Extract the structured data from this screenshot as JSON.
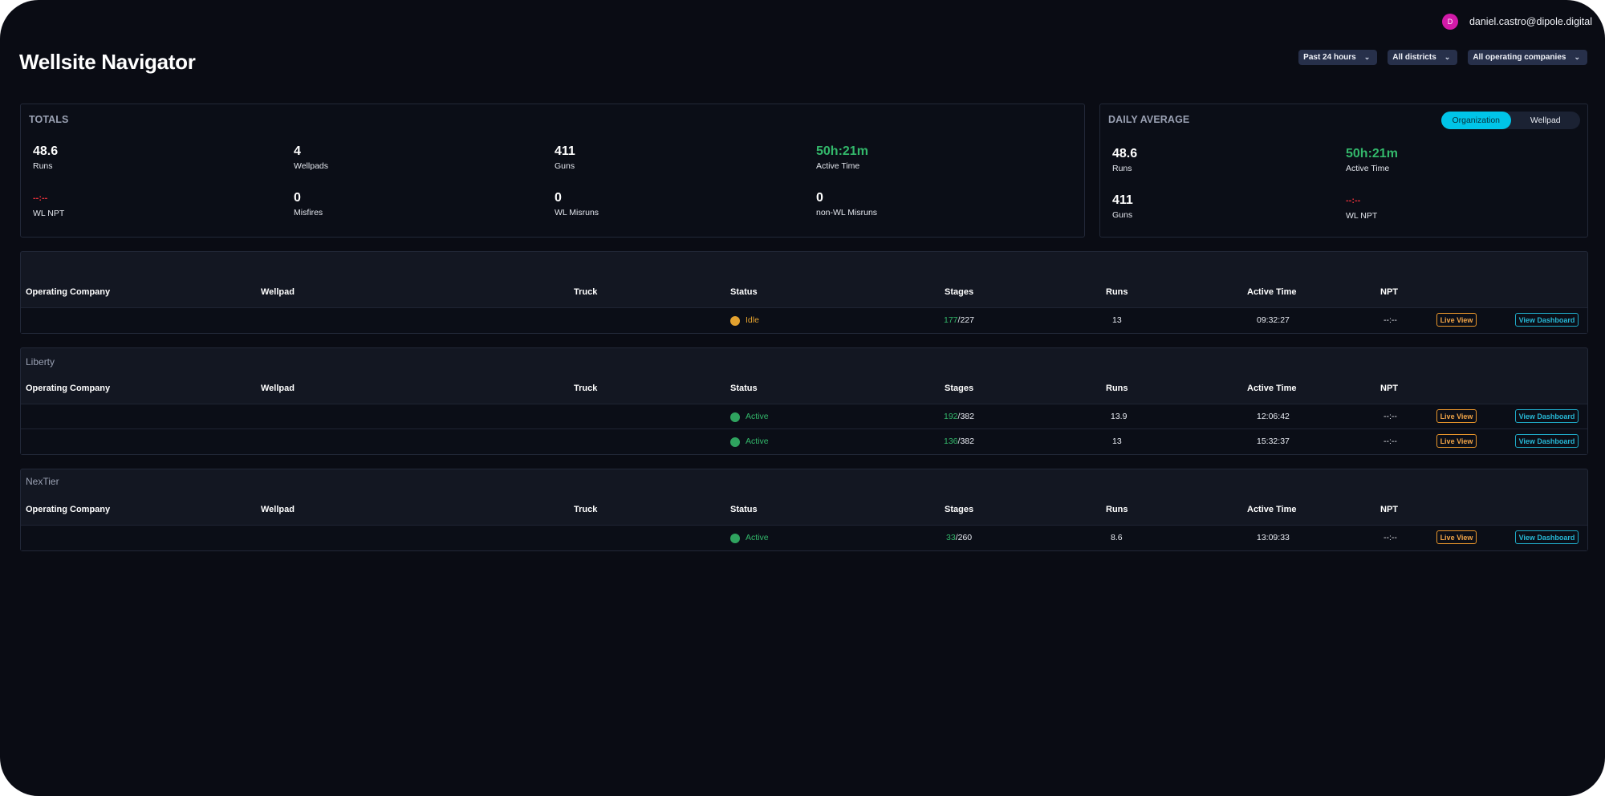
{
  "header": {
    "user_initial": "D",
    "user_email": "daniel.castro@dipole.digital",
    "title": "Wellsite Navigator"
  },
  "filters": [
    {
      "label": "Past 24 hours"
    },
    {
      "label": "All districts"
    },
    {
      "label": "All operating companies"
    }
  ],
  "totals": {
    "title": "TOTALS",
    "stats": [
      {
        "value": "48.6",
        "label": "Runs"
      },
      {
        "value": "4",
        "label": "Wellpads"
      },
      {
        "value": "411",
        "label": "Guns"
      },
      {
        "value": "50h:21m",
        "label": "Active Time"
      },
      {
        "value": "--:--",
        "label": "WL NPT"
      },
      {
        "value": "0",
        "label": "Misfires"
      },
      {
        "value": "0",
        "label": "WL Misruns"
      },
      {
        "value": "0",
        "label": "non-WL Misruns"
      }
    ]
  },
  "daily_average": {
    "title": "DAILY AVERAGE",
    "toggle": {
      "options": [
        "Organization",
        "Wellpad"
      ],
      "selected": "Organization"
    },
    "stats": [
      {
        "value": "48.6",
        "label": "Runs"
      },
      {
        "value": "50h:21m",
        "label": "Active Time"
      },
      {
        "value": "411",
        "label": "Guns"
      },
      {
        "value": "--:--",
        "label": "WL NPT"
      }
    ]
  },
  "columns": [
    "Operating Company",
    "Wellpad",
    "Truck",
    "Status",
    "Stages",
    "Runs",
    "Active Time",
    "NPT"
  ],
  "buttons": {
    "live": "Live View",
    "dashboard": "View Dashboard"
  },
  "colors": {
    "idle": "#e3a12f",
    "active": "#2fa35f",
    "accent": "#00c4e8"
  },
  "groups": [
    {
      "name": "",
      "rows": [
        {
          "status": "Idle",
          "stages_done": "177",
          "stages_total": "/227",
          "runs": "13",
          "active_time": "09:32:27",
          "npt": "--:--"
        }
      ]
    },
    {
      "name": "Liberty",
      "rows": [
        {
          "status": "Active",
          "stages_done": "192",
          "stages_total": "/382",
          "runs": "13.9",
          "active_time": "12:06:42",
          "npt": "--:--"
        },
        {
          "status": "Active",
          "stages_done": "136",
          "stages_total": "/382",
          "runs": "13",
          "active_time": "15:32:37",
          "npt": "--:--"
        }
      ]
    },
    {
      "name": "NexTier",
      "rows": [
        {
          "status": "Active",
          "stages_done": "33",
          "stages_total": "/260",
          "runs": "8.6",
          "active_time": "13:09:33",
          "npt": "--:--"
        }
      ]
    }
  ]
}
